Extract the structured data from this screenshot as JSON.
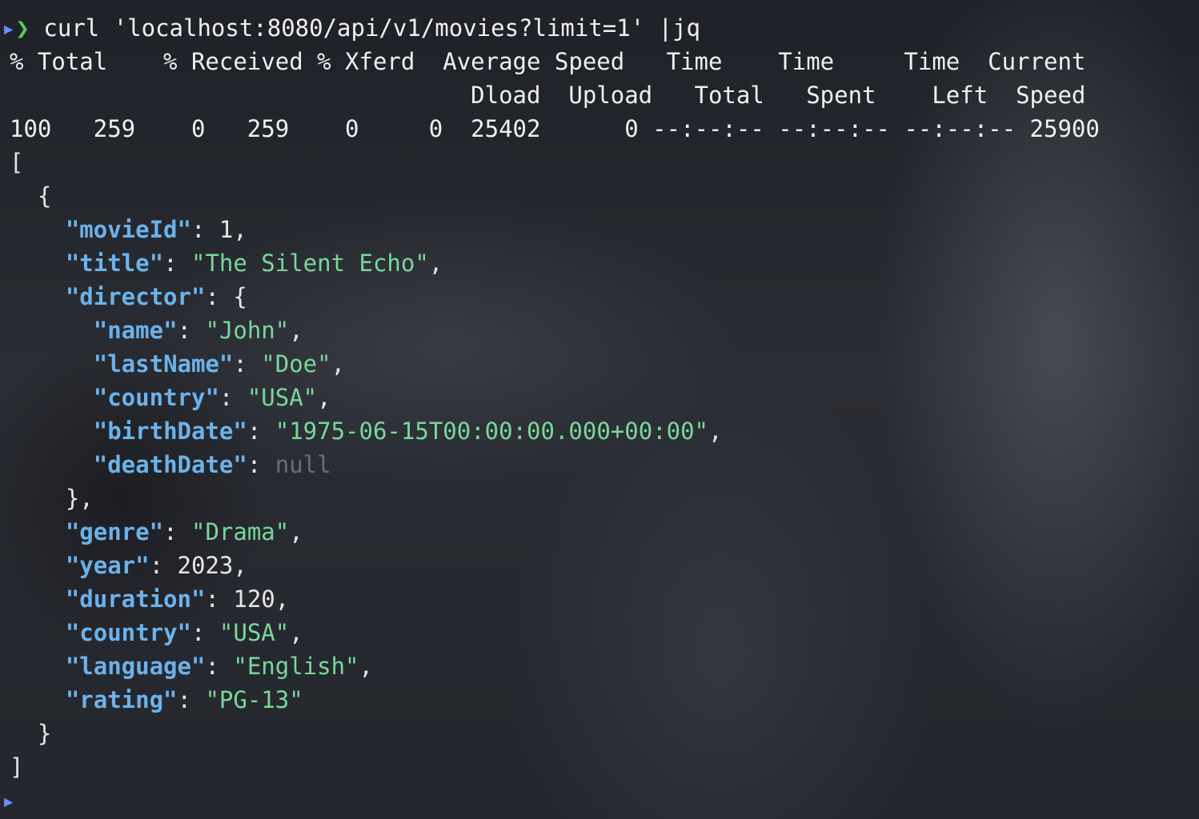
{
  "prompt": {
    "symbol": "❯",
    "command": "curl 'localhost:8080/api/v1/movies?limit=1' |jq"
  },
  "curl_progress": {
    "header1": "% Total    % Received % Xferd  Average Speed   Time    Time     Time  Current",
    "header2": "                                 Dload  Upload   Total   Spent    Left  Speed",
    "values": "100   259    0   259    0     0  25402      0 --:--:-- --:--:-- --:--:-- 25900"
  },
  "json_output": {
    "open_array": "[",
    "open_obj": "{",
    "fields": [
      {
        "key": "\"movieId\"",
        "value": "1",
        "type": "num",
        "suffix": ","
      },
      {
        "key": "\"title\"",
        "value": "\"The Silent Echo\"",
        "type": "str",
        "suffix": ","
      },
      {
        "key": "\"director\"",
        "value": "{",
        "type": "punct",
        "suffix": ""
      }
    ],
    "director_fields": [
      {
        "key": "\"name\"",
        "value": "\"John\"",
        "type": "str",
        "suffix": ","
      },
      {
        "key": "\"lastName\"",
        "value": "\"Doe\"",
        "type": "str",
        "suffix": ","
      },
      {
        "key": "\"country\"",
        "value": "\"USA\"",
        "type": "str",
        "suffix": ","
      },
      {
        "key": "\"birthDate\"",
        "value": "\"1975-06-15T00:00:00.000+00:00\"",
        "type": "str",
        "suffix": ","
      },
      {
        "key": "\"deathDate\"",
        "value": "null",
        "type": "null",
        "suffix": ""
      }
    ],
    "close_director": "},",
    "rest_fields": [
      {
        "key": "\"genre\"",
        "value": "\"Drama\"",
        "type": "str",
        "suffix": ","
      },
      {
        "key": "\"year\"",
        "value": "2023",
        "type": "num",
        "suffix": ","
      },
      {
        "key": "\"duration\"",
        "value": "120",
        "type": "num",
        "suffix": ","
      },
      {
        "key": "\"country\"",
        "value": "\"USA\"",
        "type": "str",
        "suffix": ","
      },
      {
        "key": "\"language\"",
        "value": "\"English\"",
        "type": "str",
        "suffix": ","
      },
      {
        "key": "\"rating\"",
        "value": "\"PG-13\"",
        "type": "str",
        "suffix": ""
      }
    ],
    "close_obj": "}",
    "close_array": "]"
  },
  "next_prompt": {
    "symbol": "❯"
  }
}
